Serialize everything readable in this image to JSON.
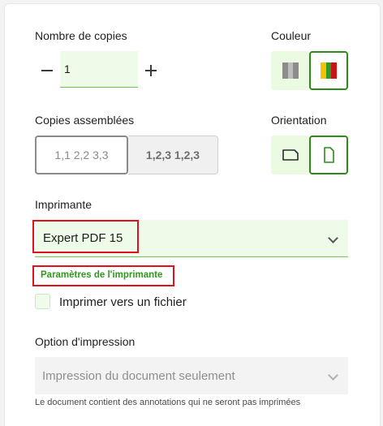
{
  "copies": {
    "label": "Nombre de copies",
    "value": "1"
  },
  "color": {
    "label": "Couleur",
    "options": [
      "grayscale",
      "color"
    ],
    "selected": "color"
  },
  "collate": {
    "label": "Copies assemblées",
    "option_uncollated": "1,1 2,2 3,3",
    "option_collated": "1,2,3 1,2,3"
  },
  "orientation": {
    "label": "Orientation",
    "options": [
      "landscape",
      "portrait"
    ],
    "selected": "portrait"
  },
  "printer": {
    "label": "Imprimante",
    "selected": "Expert PDF 15",
    "settings_link": "Paramètres de l'imprimante"
  },
  "print_to_file": {
    "label": "Imprimer vers un fichier",
    "checked": false
  },
  "print_option": {
    "label": "Option d'impression",
    "selected": "Impression du document seulement",
    "note": "Le document contient des annotations qui ne seront pas imprimées"
  },
  "colors": {
    "accent": "#2c8a1a",
    "field_bg": "#eefbe8",
    "highlight": "#e0101e"
  }
}
